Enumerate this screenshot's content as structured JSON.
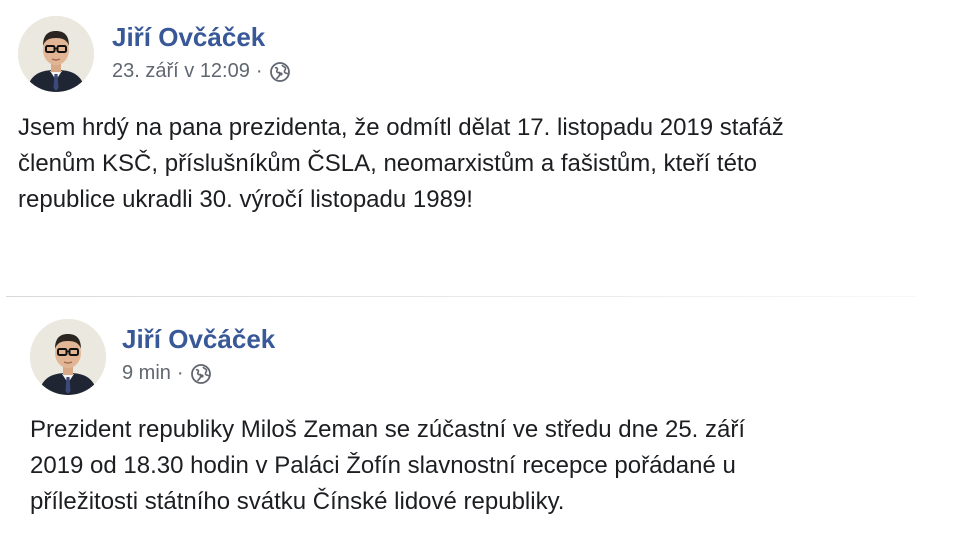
{
  "posts": [
    {
      "author": "Jiří Ovčáček",
      "timestamp": "23. září v 12:09",
      "separator": "·",
      "privacy_icon": "globe-icon",
      "text_lines": [
        "Jsem hrdý na pana prezidenta, že odmítl dělat 17. listopadu 2019 stafáž",
        "členům KSČ, příslušníkům ČSLA, neomarxistům a fašistům, kteří této",
        "republice ukradli 30. výročí listopadu 1989!"
      ]
    },
    {
      "author": "Jiří Ovčáček",
      "timestamp": "9 min",
      "separator": "·",
      "privacy_icon": "globe-icon",
      "text_lines": [
        "Prezident republiky Miloš Zeman se zúčastní ve středu dne 25. září",
        "2019 od 18.30 hodin v Paláci Žofín slavnostní recepce pořádané u",
        "příležitosti státního svátku Čínské lidové republiky."
      ]
    }
  ],
  "colors": {
    "author_link": "#385898",
    "meta_text": "#606770",
    "body_text": "#1c1e21"
  }
}
